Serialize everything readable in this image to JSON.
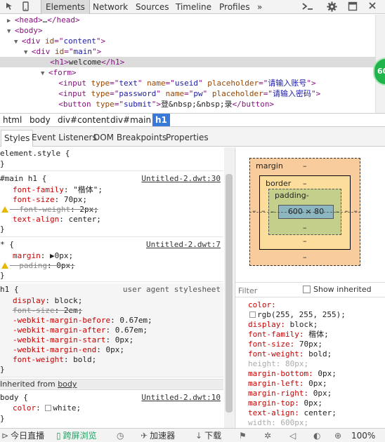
{
  "toolbar": {
    "tabs": [
      "Elements",
      "Network",
      "Sources",
      "Timeline",
      "Profiles"
    ],
    "more": "»",
    "icons": [
      "inspect-icon",
      "device-icon",
      "console-icon",
      "settings-icon",
      "dock-icon",
      "close-icon"
    ]
  },
  "elements": {
    "lines": [
      {
        "tri": "▶",
        "parts": [
          [
            "tag",
            "<head>"
          ],
          [
            "tx",
            "…"
          ],
          [
            "tag",
            "</head>"
          ]
        ]
      },
      {
        "tri": "▼",
        "parts": [
          [
            "tag",
            "<body>"
          ]
        ]
      },
      {
        "tri": "▼",
        "parts": [
          [
            "tag",
            "<div "
          ],
          [
            "an",
            "id"
          ],
          [
            "tag",
            "=\""
          ],
          [
            "av",
            "content"
          ],
          [
            "tag",
            "\">"
          ]
        ]
      },
      {
        "tri": "▼",
        "parts": [
          [
            "tag",
            "<div "
          ],
          [
            "an",
            "id"
          ],
          [
            "tag",
            "=\""
          ],
          [
            "av",
            "main"
          ],
          [
            "tag",
            "\">"
          ]
        ]
      },
      {
        "tri": "",
        "parts": [
          [
            "tag",
            "<h1>"
          ],
          [
            "tx",
            "welcome"
          ],
          [
            "tag",
            "</h1>"
          ]
        ]
      },
      {
        "tri": "▼",
        "parts": [
          [
            "tag",
            "<form>"
          ]
        ]
      },
      {
        "tri": "",
        "parts": [
          [
            "tag",
            "<input "
          ],
          [
            "an",
            "type"
          ],
          [
            "tag",
            "=\""
          ],
          [
            "av",
            "text"
          ],
          [
            "tag",
            "\" "
          ],
          [
            "an",
            "name"
          ],
          [
            "tag",
            "=\""
          ],
          [
            "av",
            "useid"
          ],
          [
            "tag",
            "\" "
          ],
          [
            "an",
            "placeholder"
          ],
          [
            "tag",
            "=\""
          ],
          [
            "av",
            "请输入账号"
          ],
          [
            "tag",
            "\">"
          ]
        ]
      },
      {
        "tri": "",
        "parts": [
          [
            "tag",
            "<input "
          ],
          [
            "an",
            "type"
          ],
          [
            "tag",
            "=\""
          ],
          [
            "av",
            "password"
          ],
          [
            "tag",
            "\" "
          ],
          [
            "an",
            "name"
          ],
          [
            "tag",
            "=\""
          ],
          [
            "av",
            "pw"
          ],
          [
            "tag",
            "\" "
          ],
          [
            "an",
            "placeholder"
          ],
          [
            "tag",
            "=\""
          ],
          [
            "av",
            "请输入密码"
          ],
          [
            "tag",
            "\">"
          ]
        ]
      },
      {
        "tri": "",
        "parts": [
          [
            "tag",
            "<button "
          ],
          [
            "an",
            "type"
          ],
          [
            "tag",
            "=\""
          ],
          [
            "av",
            "submit"
          ],
          [
            "tag",
            "\">"
          ],
          [
            "tx",
            "登&nbsp;&nbsp;录"
          ],
          [
            "tag",
            "</button>"
          ]
        ]
      }
    ],
    "badge": "60"
  },
  "breadcrumb": [
    "html",
    "body",
    "div#content",
    "div#main",
    "h1"
  ],
  "subtabs": [
    "Styles",
    "Event Listeners",
    "DOM Breakpoints",
    "Properties"
  ],
  "styles": {
    "element_style": [
      "element.style {",
      "}"
    ],
    "rule_main_h1": {
      "selector": "#main h1 {",
      "source": "Untitled-2.dwt:30",
      "decls": [
        {
          "prop": "font-family",
          "val": "\"楷体\";",
          "struck": false,
          "warn": false
        },
        {
          "prop": "font-size",
          "val": "70px;",
          "struck": false,
          "warn": false
        },
        {
          "prop": "font-weight",
          "val": "2px;",
          "struck": true,
          "warn": true
        },
        {
          "prop": "text-align",
          "val": "center;",
          "struck": false,
          "warn": false
        }
      ]
    },
    "rule_star": {
      "selector": "* {",
      "source": "Untitled-2.dwt:7",
      "decls": [
        {
          "prop": "margin",
          "val": "▶0px;",
          "struck": false,
          "warn": false
        },
        {
          "prop": "pading",
          "val": "0px;",
          "struck": true,
          "warn": true
        }
      ]
    },
    "rule_h1": {
      "selector": "h1 {",
      "source": "user agent stylesheet",
      "decls": [
        {
          "prop": "display",
          "val": "block;",
          "struck": false
        },
        {
          "prop": "font-size",
          "val": "2em;",
          "struck": true
        },
        {
          "prop": "-webkit-margin-before",
          "val": "0.67em;",
          "struck": false
        },
        {
          "prop": "-webkit-margin-after",
          "val": "0.67em;",
          "struck": false
        },
        {
          "prop": "-webkit-margin-start",
          "val": "0px;",
          "struck": false
        },
        {
          "prop": "-webkit-margin-end",
          "val": "0px;",
          "struck": false
        },
        {
          "prop": "font-weight",
          "val": "bold;",
          "struck": false
        }
      ]
    },
    "inherited_label": "Inherited from ",
    "inherited_from": "body",
    "rule_body": {
      "selector": "body {",
      "source": "Untitled-2.dwt:10",
      "prop": "color",
      "val": "white;"
    },
    "close_brace": "}"
  },
  "boxmodel": {
    "margin_label": "margin",
    "border_label": "border",
    "padding_label": "padding-",
    "content": "600 × 80",
    "dash": "–"
  },
  "computed": {
    "filter_placeholder": "Filter",
    "show_inherited": "Show inherited",
    "lines": [
      {
        "prop": "color",
        "val": "",
        "dim": false
      },
      {
        "prop": "",
        "val": "rgb(255, 255, 255);",
        "dim": false,
        "swatch": true
      },
      {
        "prop": "display",
        "val": "block;",
        "dim": false
      },
      {
        "prop": "font-family",
        "val": "楷体;",
        "dim": false
      },
      {
        "prop": "font-size",
        "val": "70px;",
        "dim": false
      },
      {
        "prop": "font-weight",
        "val": "bold;",
        "dim": false
      },
      {
        "prop": "height",
        "val": "80px;",
        "dim": true
      },
      {
        "prop": "margin-bottom",
        "val": "0px;",
        "dim": false
      },
      {
        "prop": "margin-left",
        "val": "0px;",
        "dim": false
      },
      {
        "prop": "margin-right",
        "val": "0px;",
        "dim": false
      },
      {
        "prop": "margin-top",
        "val": "0px;",
        "dim": false
      },
      {
        "prop": "text-align",
        "val": "center;",
        "dim": false
      },
      {
        "prop": "width",
        "val": "600px;",
        "dim": true
      }
    ]
  },
  "statusbar": {
    "live": "今日直播",
    "fullscreen": "跨屏浏览",
    "accelerator": "加速器",
    "download": "下载",
    "zoom": "100%"
  }
}
